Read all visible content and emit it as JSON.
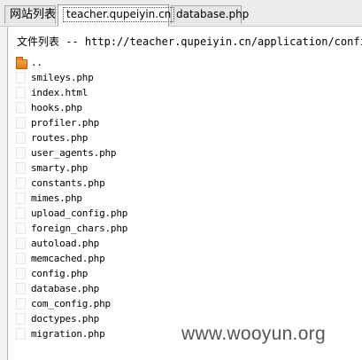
{
  "tabs": [
    {
      "label": "网站列表",
      "active": false
    },
    {
      "label": "teacher.qupeiyin.cn",
      "active": true
    },
    {
      "label": "database.php",
      "active": false
    }
  ],
  "panel": {
    "path_label": "文件列表",
    "path_sep": " -- ",
    "path": "http://teacher.qupeiyin.cn/application/config/"
  },
  "files": [
    {
      "name": "..",
      "type": "folder",
      "icon": "folder-up-icon"
    },
    {
      "name": "smileys.php",
      "type": "file",
      "icon": "file-icon"
    },
    {
      "name": "index.html",
      "type": "file",
      "icon": "file-icon"
    },
    {
      "name": "hooks.php",
      "type": "file",
      "icon": "file-icon"
    },
    {
      "name": "profiler.php",
      "type": "file",
      "icon": "file-icon"
    },
    {
      "name": "routes.php",
      "type": "file",
      "icon": "file-icon"
    },
    {
      "name": "user_agents.php",
      "type": "file",
      "icon": "file-icon"
    },
    {
      "name": "smarty.php",
      "type": "file",
      "icon": "file-icon"
    },
    {
      "name": "constants.php",
      "type": "file",
      "icon": "file-icon"
    },
    {
      "name": "mimes.php",
      "type": "file",
      "icon": "file-icon"
    },
    {
      "name": "upload_config.php",
      "type": "file",
      "icon": "file-icon"
    },
    {
      "name": "foreign_chars.php",
      "type": "file",
      "icon": "file-icon"
    },
    {
      "name": "autoload.php",
      "type": "file",
      "icon": "file-icon"
    },
    {
      "name": "memcached.php",
      "type": "file",
      "icon": "file-icon"
    },
    {
      "name": "config.php",
      "type": "file",
      "icon": "file-icon"
    },
    {
      "name": "database.php",
      "type": "file",
      "icon": "file-icon"
    },
    {
      "name": "com_config.php",
      "type": "file",
      "icon": "file-icon"
    },
    {
      "name": "doctypes.php",
      "type": "file",
      "icon": "file-icon"
    },
    {
      "name": "migration.php",
      "type": "file",
      "icon": "file-icon"
    }
  ],
  "watermark": "www.wooyun.org",
  "colors": {
    "folder": "#e8861f",
    "background": "#ffffff",
    "tabbar": "#ececec"
  }
}
